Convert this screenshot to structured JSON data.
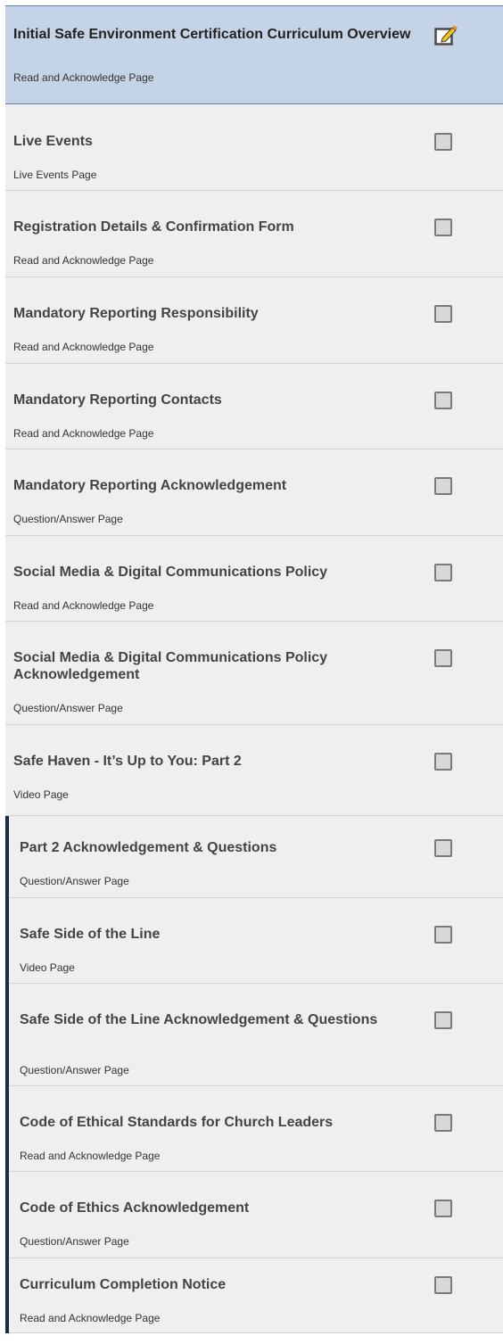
{
  "curriculum": {
    "items": [
      {
        "title": "Initial Safe Environment Certification Curriculum Overview",
        "subtitle": "Read and Acknowledge Page",
        "state": "active",
        "icon": "edit-icon"
      },
      {
        "title": "Live Events",
        "subtitle": "Live Events Page",
        "state": "incomplete",
        "icon": "checkbox-icon"
      },
      {
        "title": "Registration Details & Confirmation Form",
        "subtitle": "Read and Acknowledge Page",
        "state": "incomplete",
        "icon": "checkbox-icon"
      },
      {
        "title": "Mandatory Reporting Responsibility",
        "subtitle": "Read and Acknowledge Page",
        "state": "incomplete",
        "icon": "checkbox-icon"
      },
      {
        "title": "Mandatory Reporting Contacts",
        "subtitle": "Read and Acknowledge Page",
        "state": "incomplete",
        "icon": "checkbox-icon"
      },
      {
        "title": "Mandatory Reporting Acknowledgement",
        "subtitle": "Question/Answer Page",
        "state": "incomplete",
        "icon": "checkbox-icon"
      },
      {
        "title": "Social Media & Digital Communications Policy",
        "subtitle": "Read and Acknowledge Page",
        "state": "incomplete",
        "icon": "checkbox-icon"
      },
      {
        "title": "Social Media & Digital Communications Policy Acknowledgement",
        "subtitle": "Question/Answer Page",
        "state": "incomplete",
        "icon": "checkbox-icon"
      },
      {
        "title": "Safe Haven - It’s Up to You: Part 2",
        "subtitle": "Video Page",
        "state": "incomplete",
        "icon": "checkbox-icon"
      },
      {
        "title": "Part 2 Acknowledgement & Questions",
        "subtitle": "Question/Answer Page",
        "state": "incomplete",
        "icon": "checkbox-icon"
      },
      {
        "title": "Safe Side of the Line",
        "subtitle": "Video Page",
        "state": "incomplete",
        "icon": "checkbox-icon"
      },
      {
        "title": "Safe Side of the Line Acknowledgement & Questions",
        "subtitle": "Question/Answer Page",
        "state": "incomplete",
        "icon": "checkbox-icon"
      },
      {
        "title": "Code of Ethical Standards for Church Leaders",
        "subtitle": "Read and Acknowledge Page",
        "state": "incomplete",
        "icon": "checkbox-icon"
      },
      {
        "title": "Code of Ethics Acknowledgement",
        "subtitle": "Question/Answer Page",
        "state": "incomplete",
        "icon": "checkbox-icon"
      },
      {
        "title": "Curriculum Completion Notice",
        "subtitle": "Read and Acknowledge Page",
        "state": "incomplete",
        "icon": "checkbox-icon"
      }
    ]
  },
  "colors": {
    "active_background": "#c5d3e6",
    "item_background": "#efefef",
    "nested_indicator": "#1f2b44",
    "edit_icon_yellow": "#f5c518"
  }
}
